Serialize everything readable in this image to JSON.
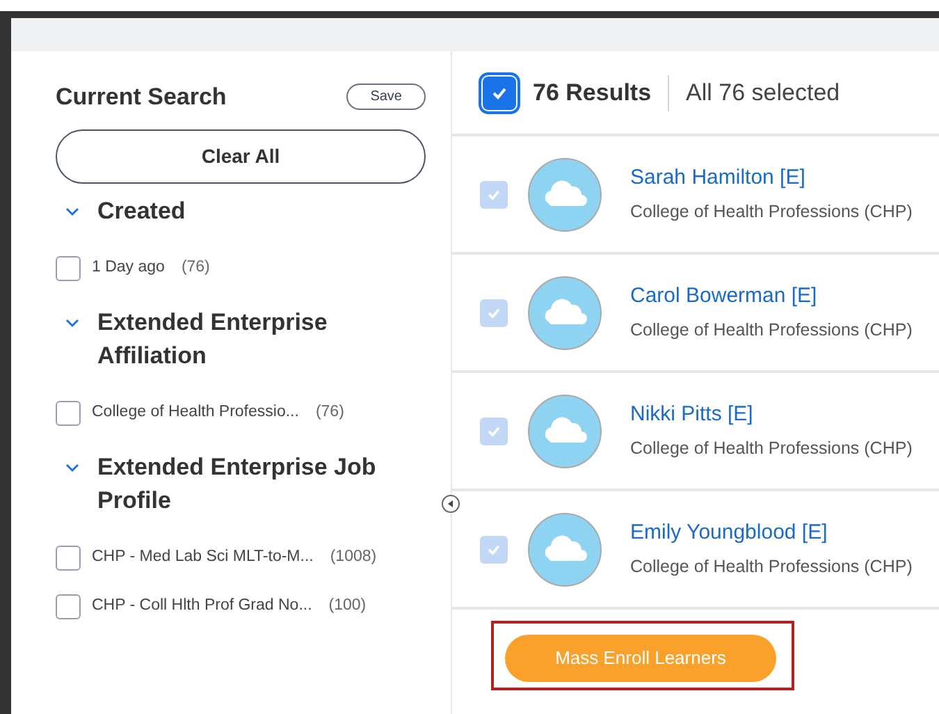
{
  "search_panel": {
    "title": "Current Search",
    "save_button": "Save",
    "clear_button": "Clear All",
    "sections": [
      {
        "title": "Created",
        "expanded": true,
        "options": [
          {
            "label": "1 Day ago",
            "count": "(76)",
            "checked": false
          }
        ]
      },
      {
        "title": "Extended Enterprise Affiliation",
        "expanded": true,
        "options": [
          {
            "label": "College of Health Professio...",
            "count": "(76)",
            "checked": false
          }
        ]
      },
      {
        "title": "Extended Enterprise Job Profile",
        "expanded": true,
        "options": [
          {
            "label": "CHP - Med Lab Sci MLT-to-M...",
            "count": "(1008)",
            "checked": false
          },
          {
            "label": "CHP - Coll Hlth Prof Grad No...",
            "count": "(100)",
            "checked": false
          }
        ]
      }
    ]
  },
  "results": {
    "select_all_checked": true,
    "count": "76 Results",
    "selection_text": "All 76 selected",
    "rows": [
      {
        "name": "Sarah Hamilton [E]",
        "org": "College of Health Professions (CHP)",
        "checked": true
      },
      {
        "name": "Carol Bowerman [E]",
        "org": "College of Health Professions (CHP)",
        "checked": true
      },
      {
        "name": "Nikki Pitts [E]",
        "org": "College of Health Professions (CHP)",
        "checked": true
      },
      {
        "name": "Emily Youngblood [E]",
        "org": "College of Health Professions (CHP)",
        "checked": true
      }
    ],
    "action_button": "Mass Enroll Learners"
  }
}
